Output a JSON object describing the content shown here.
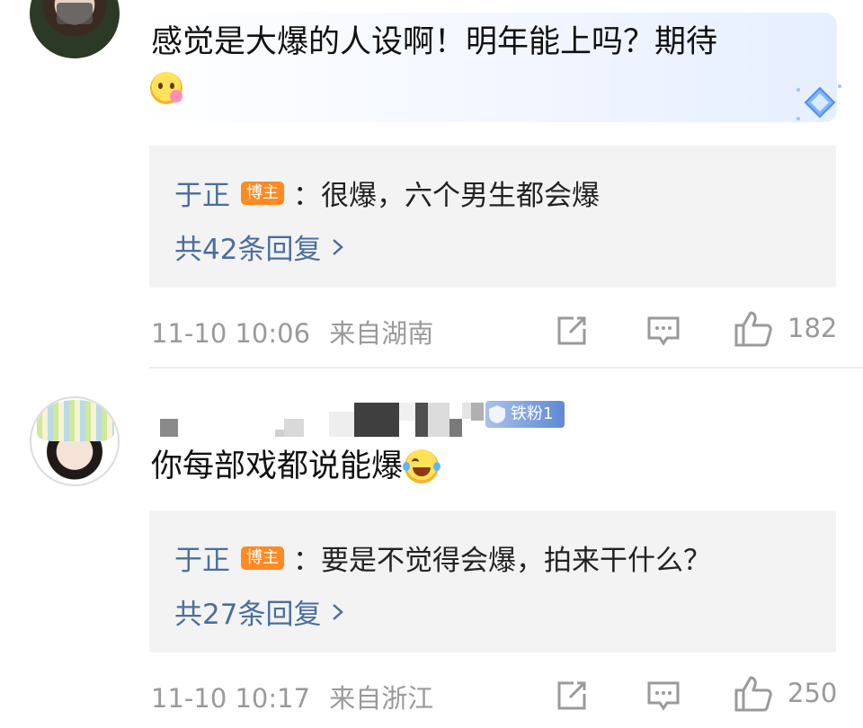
{
  "comments": [
    {
      "text": "感觉是大爆的人设啊！明年能上吗？期待",
      "emoji_icon": "smiling-face-with-flower-icon",
      "reply": {
        "user": "于正",
        "badge": "博主",
        "text": "：很爆，六个男生都会爆",
        "more": "共42条回复"
      },
      "time": "11-10 10:06",
      "location": "来自湖南",
      "likes": "182"
    },
    {
      "fan_badge": "铁粉1",
      "text": "你每部戏都说能爆",
      "emoji_icon": "tears-of-joy-icon",
      "reply": {
        "user": "于正",
        "badge": "博主",
        "text": "：要是不觉得会爆，拍来干什么？",
        "more": "共27条回复"
      },
      "time": "11-10 10:17",
      "location": "来自浙江",
      "likes": "250"
    }
  ],
  "colors": {
    "link": "#4a6f9e",
    "badge": "#ff8a22",
    "meta": "#9a9a9a",
    "reply_bg": "#f3f3f3"
  }
}
